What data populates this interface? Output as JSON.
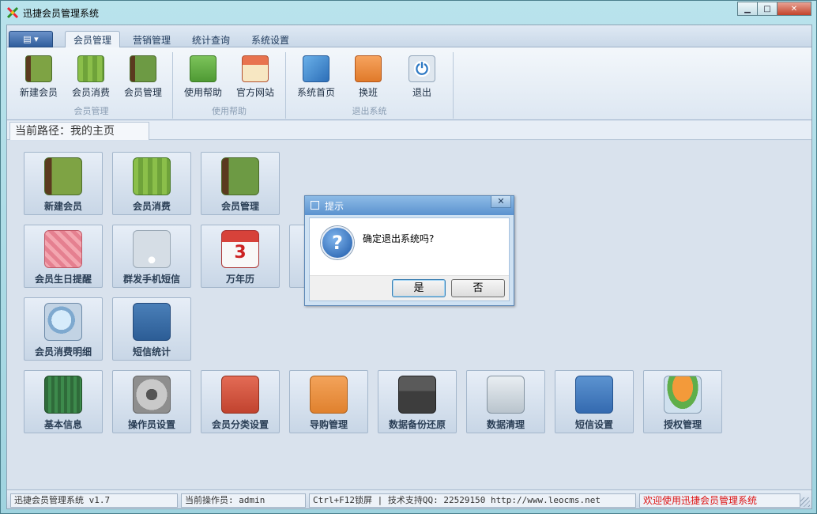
{
  "window": {
    "title": "迅捷会员管理系统",
    "min": "▁",
    "max": "□",
    "close": "✕"
  },
  "app_menu": {
    "label": "▤ ▾"
  },
  "tabs": [
    {
      "label": "会员管理",
      "active": true
    },
    {
      "label": "营销管理",
      "active": false
    },
    {
      "label": "统计查询",
      "active": false
    },
    {
      "label": "系统设置",
      "active": false
    }
  ],
  "ribbon": {
    "groups": [
      {
        "label": "会员管理",
        "buttons": [
          {
            "label": "新建会员",
            "icon": "member-book-icon"
          },
          {
            "label": "会员消费",
            "icon": "water-drop-icon"
          },
          {
            "label": "会员管理",
            "icon": "address-book-icon"
          }
        ]
      },
      {
        "label": "使用帮助",
        "buttons": [
          {
            "label": "使用帮助",
            "icon": "chat-bubble-icon"
          },
          {
            "label": "官方网站",
            "icon": "shop-icon"
          }
        ]
      },
      {
        "label": "退出系统",
        "buttons": [
          {
            "label": "系统首页",
            "icon": "home-compass-icon"
          },
          {
            "label": "换班",
            "icon": "swap-icon"
          },
          {
            "label": "退出",
            "icon": "power-icon"
          }
        ]
      }
    ]
  },
  "path": {
    "label": "当前路径：我的主页"
  },
  "tiles": {
    "row1": [
      "新建会员",
      "会员消费",
      "会员管理"
    ],
    "row2": [
      "会员生日提醒",
      "群发手机短信",
      "万年历"
    ],
    "row3": [
      "会员消费明细",
      "短信统计"
    ],
    "row4": [
      "基本信息",
      "操作员设置",
      "会员分类设置",
      "导购管理",
      "数据备份还原",
      "数据清理",
      "短信设置",
      "授权管理"
    ],
    "calendar_digit": "3"
  },
  "dialog": {
    "title": "提示",
    "message": "确定退出系统吗?",
    "yes": "是",
    "no": "否",
    "close": "✕",
    "q": "?"
  },
  "status": {
    "version": "迅捷会员管理系统 v1.7",
    "operator": "当前操作员: admin",
    "support": "Ctrl+F12锁屏 | 技术支持QQ:  22529150       http://www.leocms.net",
    "welcome": "欢迎使用迅捷会员管理系统"
  }
}
